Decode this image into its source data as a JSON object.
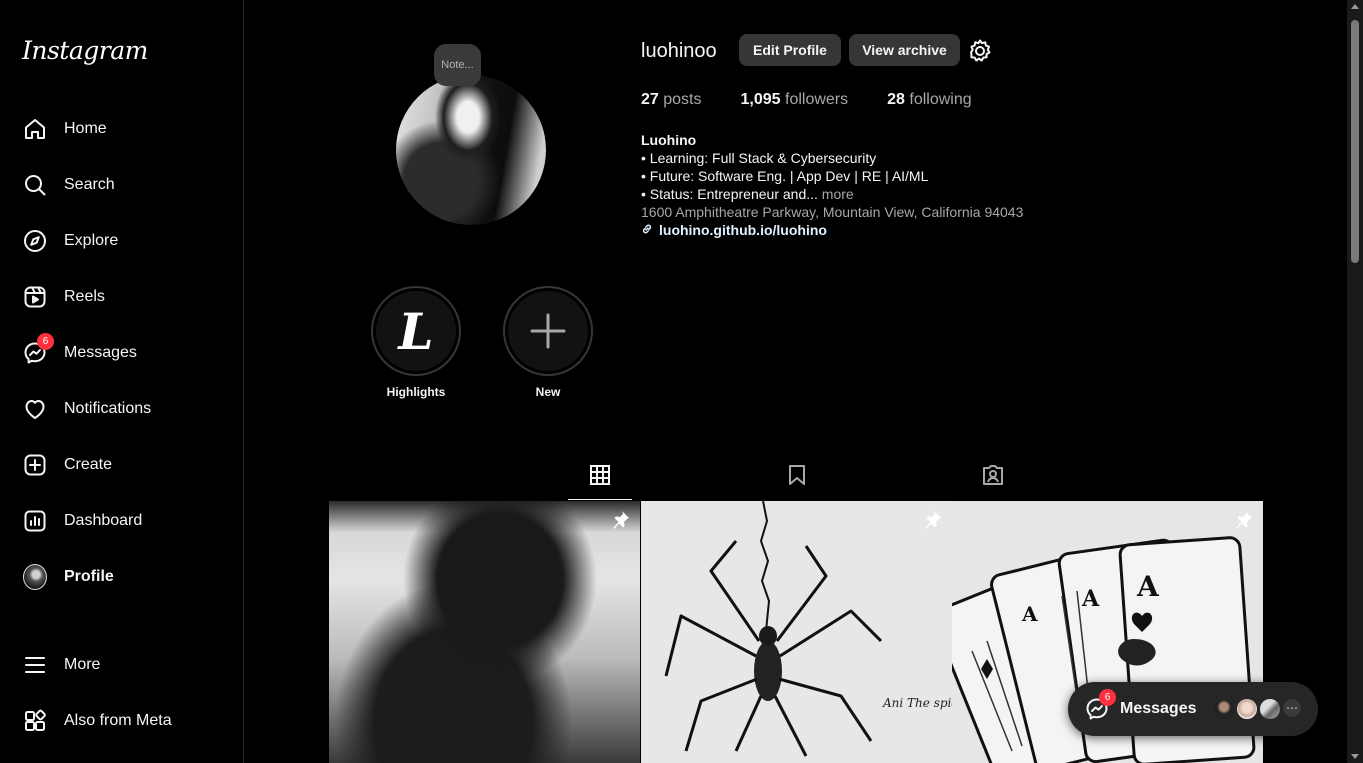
{
  "app": {
    "logo": "Instagram"
  },
  "sidebar": {
    "items": [
      {
        "label": "Home",
        "icon": "home-icon"
      },
      {
        "label": "Search",
        "icon": "search-icon"
      },
      {
        "label": "Explore",
        "icon": "compass-icon"
      },
      {
        "label": "Reels",
        "icon": "reels-icon"
      },
      {
        "label": "Messages",
        "icon": "messenger-icon",
        "badge": "6"
      },
      {
        "label": "Notifications",
        "icon": "heart-icon"
      },
      {
        "label": "Create",
        "icon": "plus-square-icon"
      },
      {
        "label": "Dashboard",
        "icon": "dashboard-icon"
      },
      {
        "label": "Profile",
        "icon": "avatar"
      }
    ],
    "bottom": [
      {
        "label": "More",
        "icon": "menu-icon"
      },
      {
        "label": "Also from Meta",
        "icon": "meta-apps-icon"
      }
    ]
  },
  "profile": {
    "note": "Note...",
    "username": "luohinoo",
    "edit_label": "Edit Profile",
    "archive_label": "View archive",
    "posts_count": "27",
    "posts_label": "posts",
    "followers_count": "1,095",
    "followers_label": "followers",
    "following_count": "28",
    "following_label": "following",
    "bio": {
      "name": "Luohino",
      "line1": "• Learning: Full Stack & Cybersecurity",
      "line2": "• Future: Software Eng. | App Dev | RE | AI/ML",
      "line3": "• Status: Entrepreneur and...",
      "more": "more",
      "address": "1600 Amphitheatre Parkway, Mountain View, California 94043",
      "link": "luohino.github.io/luohino"
    }
  },
  "highlights": [
    {
      "label": "Highlights",
      "glyph": "L"
    },
    {
      "label": "New"
    }
  ],
  "tabs": [
    {
      "icon": "grid-icon",
      "active": true
    },
    {
      "icon": "bookmark-icon",
      "active": false
    },
    {
      "icon": "tagged-icon",
      "active": false
    }
  ],
  "posts": [
    {
      "pinned": true
    },
    {
      "pinned": true,
      "caption": "Ani The spide"
    },
    {
      "pinned": true
    }
  ],
  "messages_pill": {
    "label": "Messages",
    "badge": "6"
  }
}
